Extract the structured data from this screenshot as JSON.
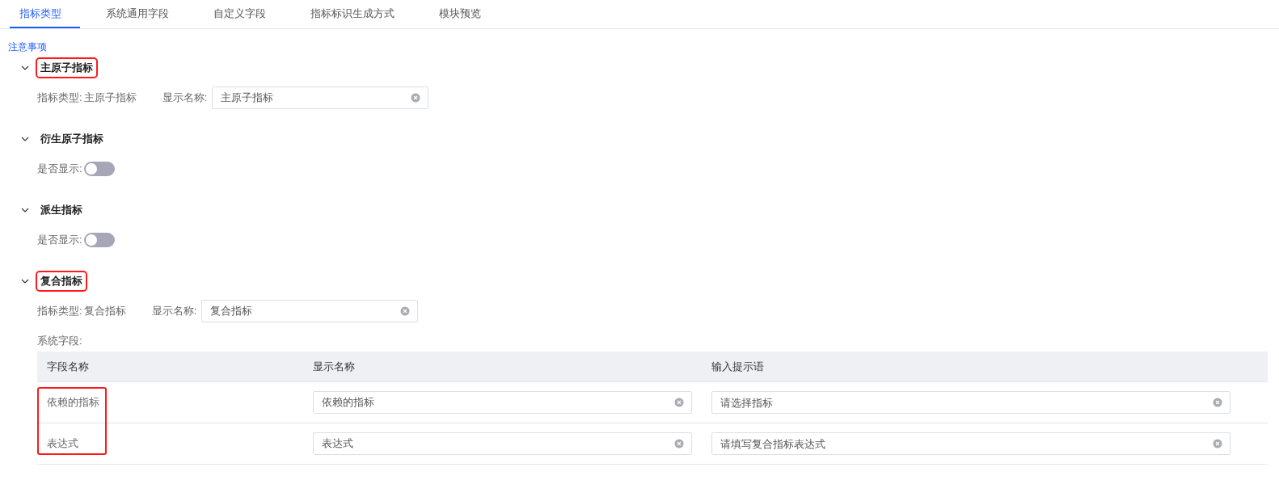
{
  "tabs": [
    {
      "label": "指标类型",
      "selected": true
    },
    {
      "label": "系统通用字段",
      "selected": false
    },
    {
      "label": "自定义字段",
      "selected": false
    },
    {
      "label": "指标标识生成方式",
      "selected": false
    },
    {
      "label": "模块预览",
      "selected": false
    }
  ],
  "notice_link": "注意事项",
  "sections": [
    {
      "title": "主原子指标",
      "expanded": true,
      "highlighted": true,
      "kind": "name",
      "type_label": "指标类型:",
      "type_value": "主原子指标",
      "display_label": "显示名称:",
      "display_value": "主原子指标"
    },
    {
      "title": "衍生原子指标",
      "expanded": true,
      "highlighted": false,
      "kind": "toggle",
      "toggle_label": "是否显示:",
      "on": false
    },
    {
      "title": "派生指标",
      "expanded": true,
      "highlighted": false,
      "kind": "toggle",
      "toggle_label": "是否显示:",
      "on": false
    },
    {
      "title": "复合指标",
      "expanded": true,
      "highlighted": true,
      "kind": "table",
      "type_label": "指标类型:",
      "type_value": "复合指标",
      "display_label": "显示名称:",
      "display_value": "复合指标",
      "fields_label": "系统字段:",
      "table": {
        "columns": [
          "字段名称",
          "显示名称",
          "输入提示语"
        ],
        "name_column_highlighted": true,
        "rows": [
          {
            "name": "依赖的指标",
            "display_value": "依赖的指标",
            "hint_placeholder": "请选择指标"
          },
          {
            "name": "表达式",
            "display_value": "表达式",
            "hint_placeholder": "请填写复合指标表达式"
          }
        ]
      }
    }
  ]
}
